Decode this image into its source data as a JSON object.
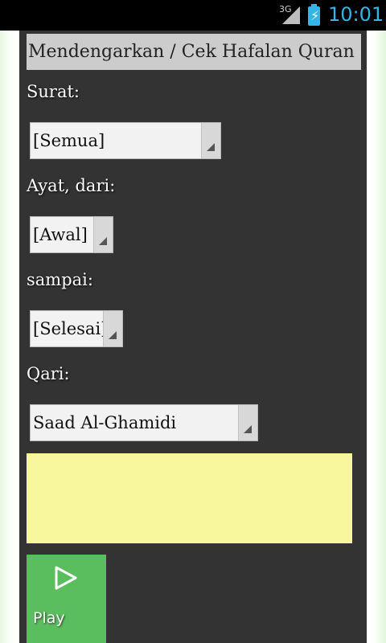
{
  "status_bar": {
    "network": "3G",
    "time": "10:01"
  },
  "title": "Mendengarkan / Cek Hafalan Quran",
  "fields": {
    "surat": {
      "label": "Surat:",
      "value": "[Semua]"
    },
    "ayat_dari": {
      "label": "Ayat, dari:",
      "value": "[Awal]"
    },
    "sampai": {
      "label": "sampai:",
      "value": "[Selesai]"
    },
    "qari": {
      "label": "Qari:",
      "value": "Saad Al-Ghamidi"
    }
  },
  "play_button": {
    "label": "Play",
    "icon": "play-icon"
  },
  "colors": {
    "panel": "#333333",
    "title_bg": "#cccccc",
    "text_area": "#f8f79e",
    "play_bg": "#5abe5e",
    "status_accent": "#33b5e5"
  }
}
